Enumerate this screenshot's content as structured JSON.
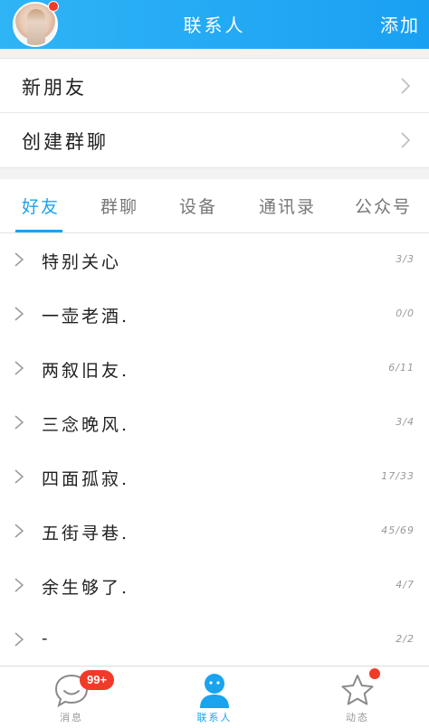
{
  "header": {
    "title": "联系人",
    "add_label": "添加",
    "brand_color": "#1aa0f2"
  },
  "top_list": {
    "new_friends": "新朋友",
    "create_group": "创建群聊"
  },
  "tabs": [
    {
      "label": "好友",
      "active": true
    },
    {
      "label": "群聊",
      "active": false
    },
    {
      "label": "设备",
      "active": false
    },
    {
      "label": "通讯录",
      "active": false
    },
    {
      "label": "公众号",
      "active": false
    }
  ],
  "groups": [
    {
      "name": "特别关心",
      "count": "3/3"
    },
    {
      "name": "一壶老酒.",
      "count": "0/0"
    },
    {
      "name": "两叙旧友.",
      "count": "6/11"
    },
    {
      "name": "三念晚风.",
      "count": "3/4"
    },
    {
      "name": "四面孤寂.",
      "count": "17/33"
    },
    {
      "name": "五街寻巷.",
      "count": "45/69"
    },
    {
      "name": "余生够了.",
      "count": "4/7"
    },
    {
      "name": "-",
      "count": "2/2"
    }
  ],
  "bottom_nav": {
    "messages": {
      "label": "消息",
      "badge": "99+",
      "icon": "chat-bubble-icon"
    },
    "contacts": {
      "label": "联系人",
      "icon": "person-icon",
      "active": true
    },
    "dynamics": {
      "label": "动态",
      "icon": "star-icon"
    }
  },
  "colors": {
    "accent": "#1aa3ee",
    "badge_red": "#f23a28"
  }
}
